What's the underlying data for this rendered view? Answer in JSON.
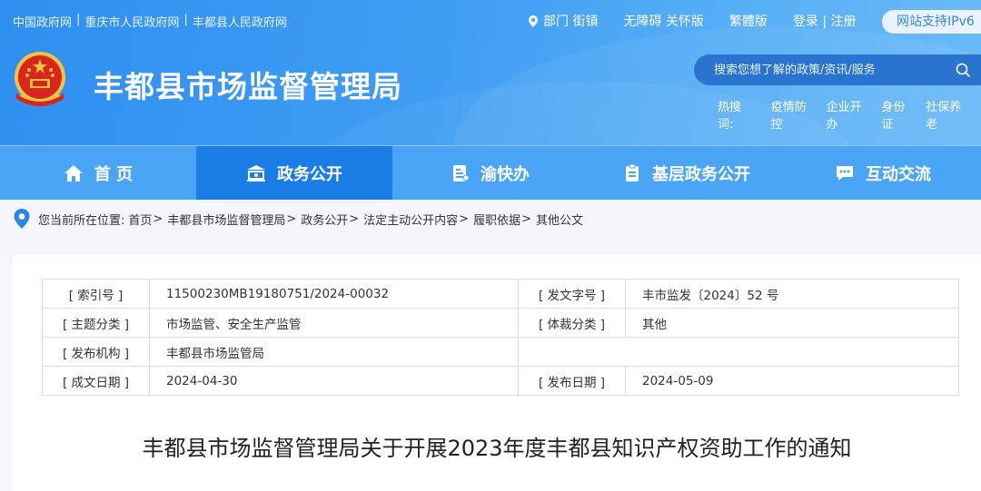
{
  "top_links": [
    "中国政府网",
    "重庆市人民政府网",
    "丰都县人民政府网"
  ],
  "top_right": {
    "location": "部门 街镇",
    "accessibility": "无障碍 关怀版",
    "traditional": "繁體版",
    "login": "登录 | 注册",
    "ipv6": "网站支持IPv6"
  },
  "site_title": "丰都县市场监督管理局",
  "search": {
    "placeholder": "搜索您想了解的政策/资讯/服务"
  },
  "hot_search": {
    "label": "热搜词:",
    "items": [
      "疫情防控",
      "企业开办",
      "身份证",
      "社保养老"
    ]
  },
  "nav": {
    "tabs": [
      {
        "label": "首 页",
        "icon": "home-icon"
      },
      {
        "label": "政务公开",
        "icon": "government-icon",
        "active": true
      },
      {
        "label": "渝快办",
        "icon": "service-icon"
      },
      {
        "label": "基层政务公开",
        "icon": "clipboard-icon"
      },
      {
        "label": "互动交流",
        "icon": "chat-icon"
      }
    ]
  },
  "breadcrumb": {
    "prefix": "您当前所在位置:",
    "items": [
      "首页",
      "丰都县市场监督管理局",
      "政务公开",
      "法定主动公开内容",
      "履职依据",
      "其他公文"
    ]
  },
  "meta": {
    "rows": [
      {
        "k1": "[ 索引号 ]",
        "v1": "11500230MB19180751/2024-00032",
        "k2": "[ 发文字号 ]",
        "v2": "丰市监发〔2024〕52 号"
      },
      {
        "k1": "[ 主题分类 ]",
        "v1": "市场监管、安全生产监管",
        "k2": "[ 体裁分类 ]",
        "v2": "其他"
      },
      {
        "k1": "[ 发布机构 ]",
        "v1": "丰都县市场监管局",
        "k2": "",
        "v2": ""
      },
      {
        "k1": "[ 成文日期 ]",
        "v1": "2024-04-30",
        "k2": "[ 发布日期 ]",
        "v2": "2024-05-09"
      }
    ]
  },
  "doc_title": "丰都县市场监督管理局关于开展2023年度丰都县知识产权资助工作的通知",
  "colors": {
    "header_blue": "#2f8ff0",
    "nav_blue": "#4aa6f5",
    "nav_active": "#1a7ee6",
    "pin_blue": "#2f86e0"
  }
}
